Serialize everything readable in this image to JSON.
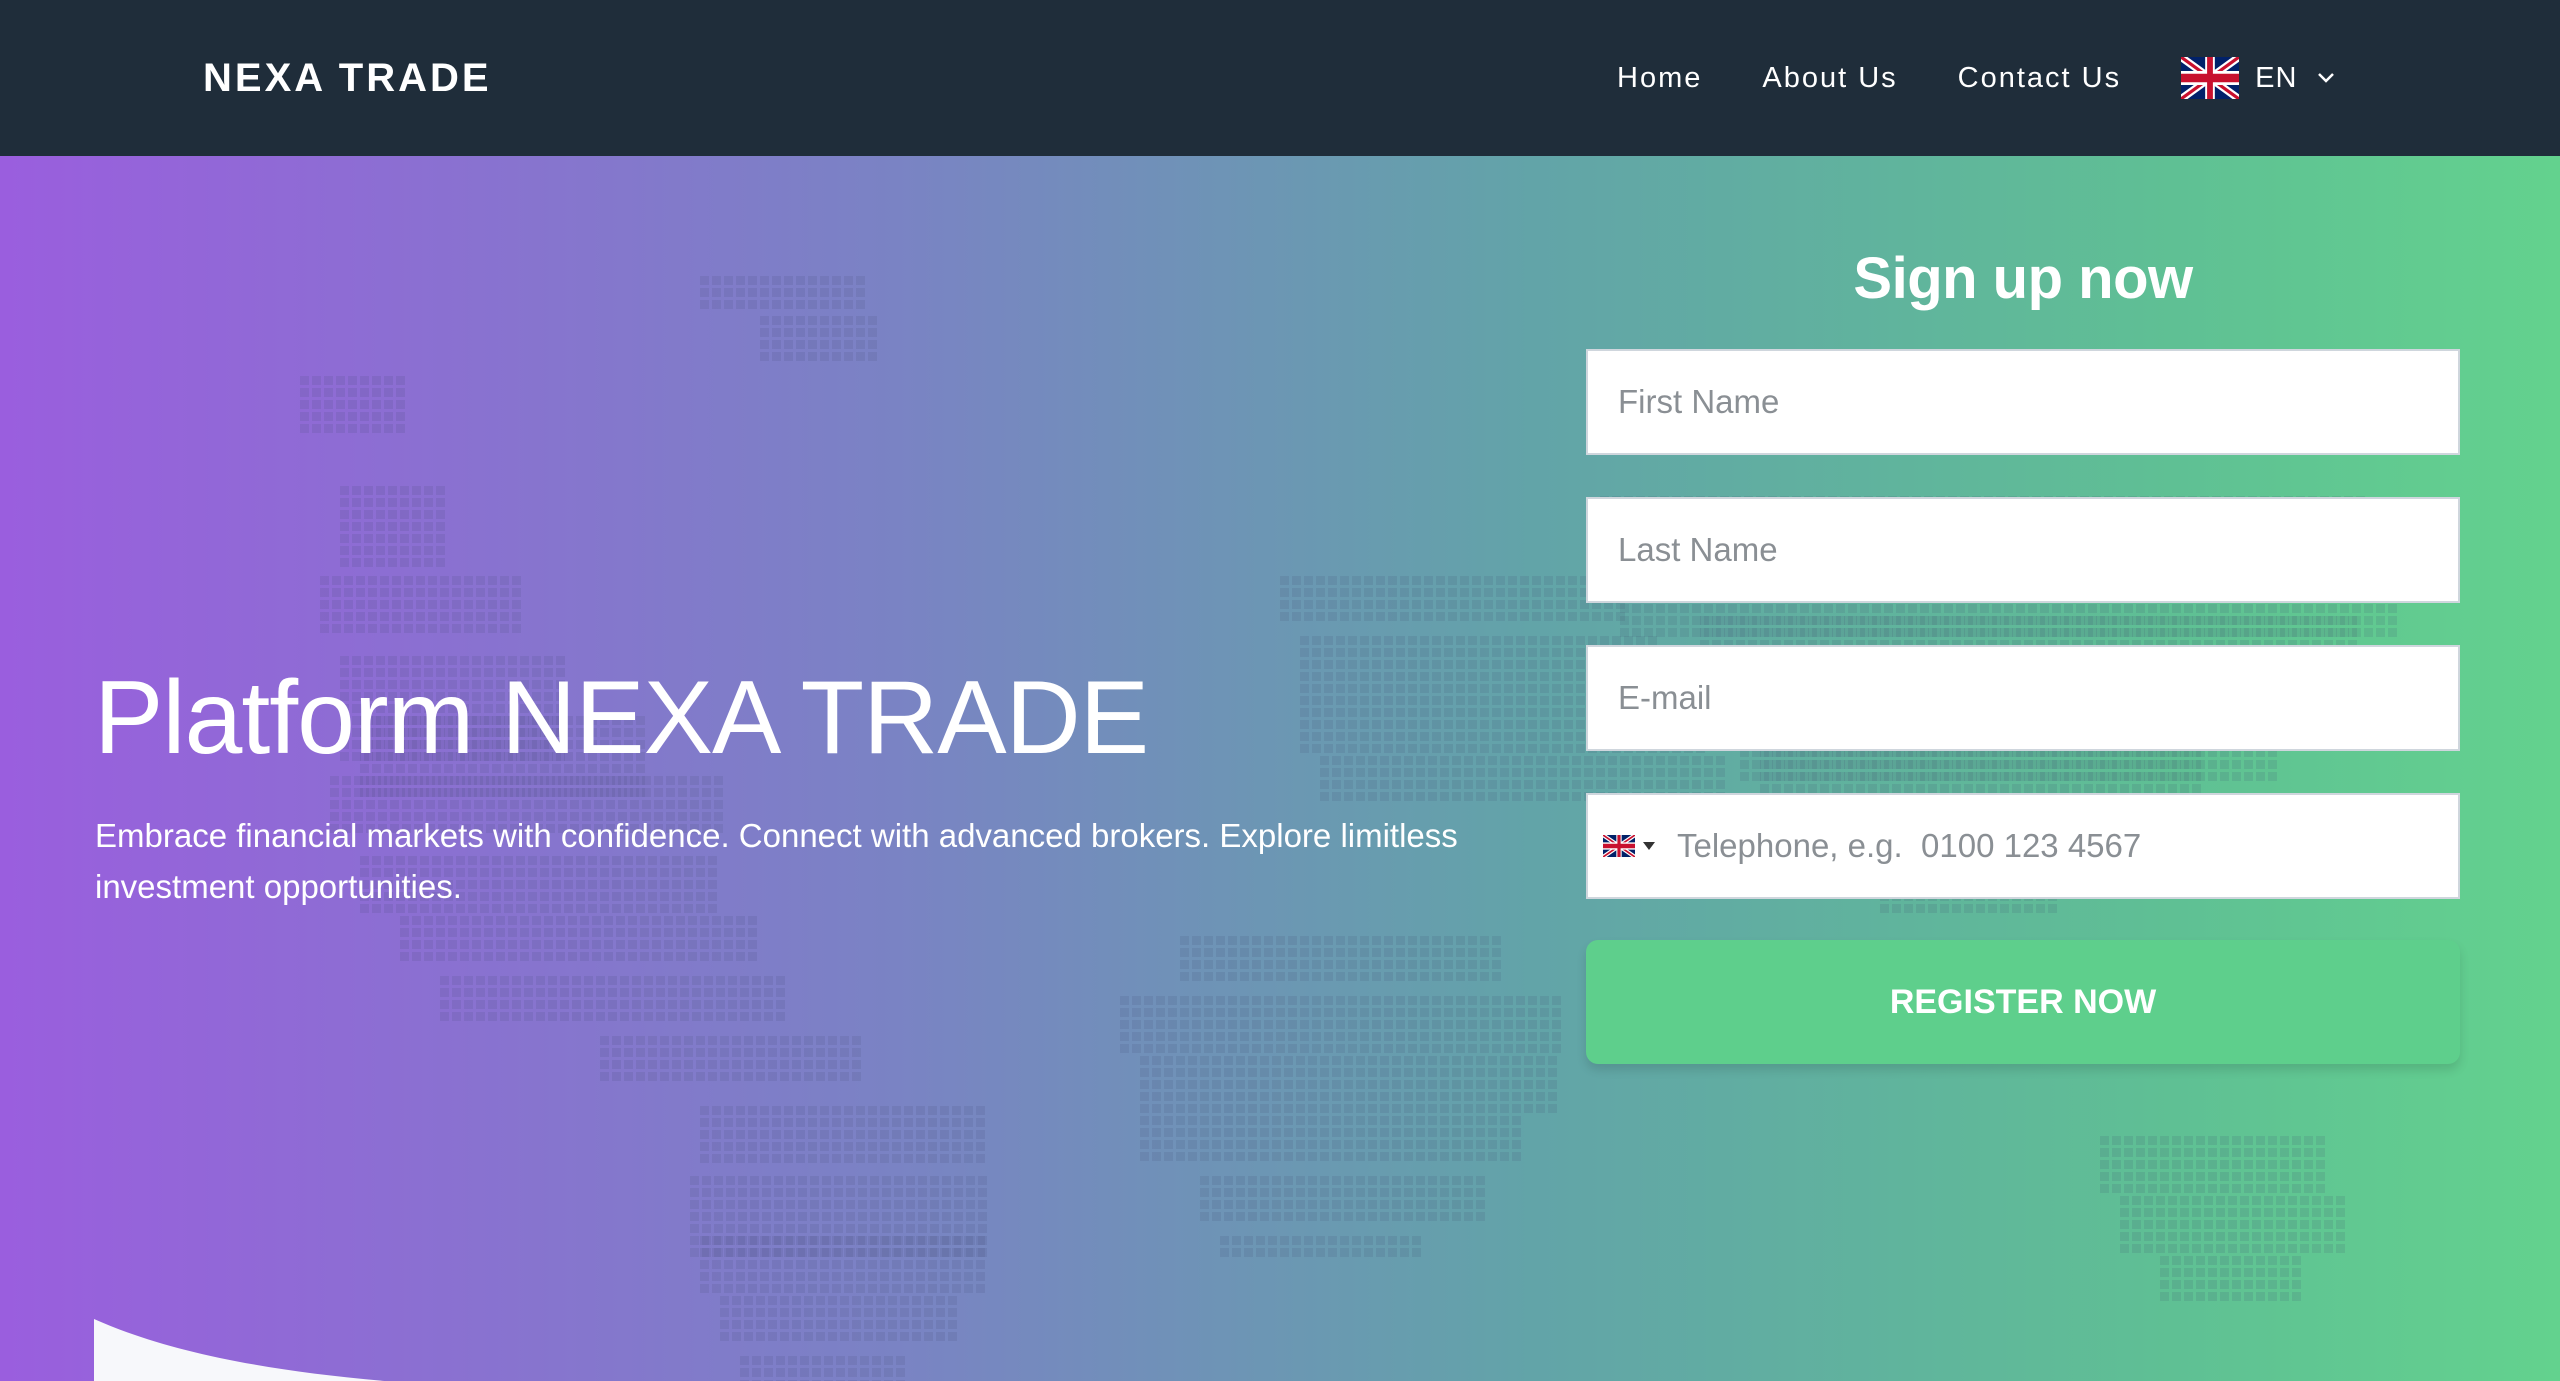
{
  "header": {
    "brand": "NEXA TRADE",
    "nav": [
      "Home",
      "About Us",
      "Contact Us"
    ],
    "language": "EN"
  },
  "hero": {
    "title": "Platform NEXA TRADE",
    "subtitle": "Embrace financial markets with confidence. Connect with advanced brokers. Explore limitless investment opportunities."
  },
  "signup": {
    "title": "Sign up now",
    "first_name_placeholder": "First Name",
    "last_name_placeholder": "Last Name",
    "email_placeholder": "E-mail",
    "phone_placeholder": "Telephone, e.g.  0100 123 4567",
    "submit_label": "REGISTER NOW"
  },
  "colors": {
    "navbar": "#1f2d3a",
    "gradient_start": "#9a5ede",
    "gradient_end": "#63d28e",
    "button": "#5ecf8c"
  },
  "icons": {
    "language_flag": "uk-flag-icon",
    "language_chevron": "chevron-down-icon",
    "phone_flag": "uk-flag-icon",
    "phone_caret": "caret-down-icon"
  }
}
